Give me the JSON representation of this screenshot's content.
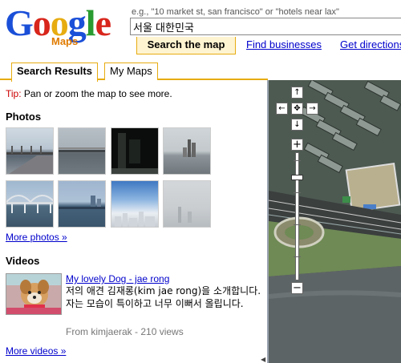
{
  "header": {
    "logo_text": "Google",
    "logo_sub": "Maps",
    "search_hint": "e.g., \"10 market st, san francisco\" or \"hotels near lax\"",
    "search_value": "서울 대한민국",
    "tabs": [
      {
        "label": "Search the map"
      },
      {
        "label": "Find businesses"
      },
      {
        "label": "Get directions"
      }
    ]
  },
  "subtabs": [
    {
      "label": "Search Results"
    },
    {
      "label": "My Maps"
    }
  ],
  "tip": {
    "label": "Tip:",
    "text": " Pan or zoom the map to see more."
  },
  "photos": {
    "title": "Photos",
    "more": "More photos »"
  },
  "videos": {
    "title": "Videos",
    "item": {
      "title": "My lovely Dog - jae rong",
      "description": "저의 애견 김재롱(kim jae rong)을 소개합니다. 자는 모습이 특이하고 너무 이뻐서 올립니다.",
      "meta": "From kimjaerak - 210 views"
    },
    "more": "More videos »"
  },
  "map_controls": {
    "pan_up": "↑",
    "pan_down": "↓",
    "pan_left": "←",
    "pan_right": "→",
    "center": "✥",
    "zoom_in": "+",
    "zoom_out": "−"
  },
  "colors": {
    "accent": "#e7ac11",
    "link": "#0000cc",
    "tip": "#cc0000"
  }
}
